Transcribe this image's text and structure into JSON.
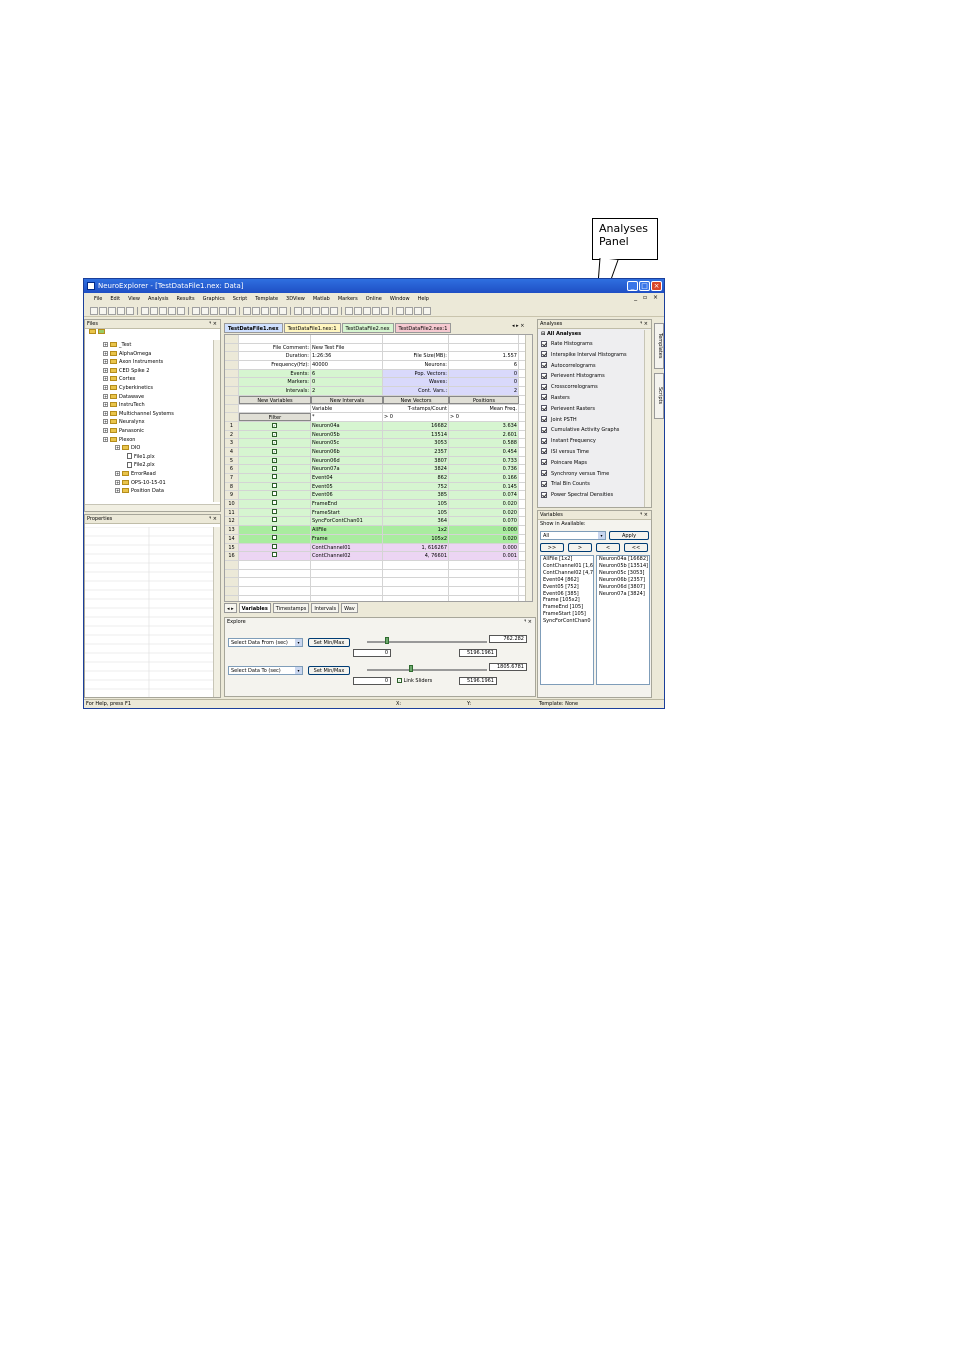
{
  "callout": {
    "line1": "Analyses",
    "line2": "Panel"
  },
  "window": {
    "title": "NeuroExplorer - [TestDataFile1.nex: Data]",
    "status": {
      "help": "For Help, press F1",
      "x": "X:",
      "y": "Y:",
      "template": "Template: None"
    }
  },
  "menu": [
    "File",
    "Edit",
    "View",
    "Analysis",
    "Results",
    "Graphics",
    "Script",
    "Template",
    "3DView",
    "Matlab",
    "Markers",
    "Online",
    "Window",
    "Help"
  ],
  "files_panel": {
    "title": "Files",
    "items": [
      {
        "label": "_Test",
        "level": 1,
        "kind": "folder"
      },
      {
        "label": "AlphaOmega",
        "level": 1,
        "kind": "folder"
      },
      {
        "label": "Axon Instruments",
        "level": 1,
        "kind": "folder"
      },
      {
        "label": "CED Spike 2",
        "level": 1,
        "kind": "folder"
      },
      {
        "label": "Cortex",
        "level": 1,
        "kind": "folder"
      },
      {
        "label": "Cyberkinetics",
        "level": 1,
        "kind": "folder"
      },
      {
        "label": "Datawave",
        "level": 1,
        "kind": "folder"
      },
      {
        "label": "InstruTech",
        "level": 1,
        "kind": "folder"
      },
      {
        "label": "Multichannel Systems",
        "level": 1,
        "kind": "folder"
      },
      {
        "label": "Neuralynx",
        "level": 1,
        "kind": "folder"
      },
      {
        "label": "Panasonic",
        "level": 1,
        "kind": "folder"
      },
      {
        "label": "Plexon",
        "level": 1,
        "kind": "folder"
      },
      {
        "label": "DIO",
        "level": 2,
        "kind": "folder"
      },
      {
        "label": "File1.plx",
        "level": 3,
        "kind": "file"
      },
      {
        "label": "File2.plx",
        "level": 3,
        "kind": "file"
      },
      {
        "label": "ErrorRead",
        "level": 2,
        "kind": "folder"
      },
      {
        "label": "OPS-10-15-01",
        "level": 2,
        "kind": "folder"
      },
      {
        "label": "Position Data",
        "level": 2,
        "kind": "folder"
      }
    ]
  },
  "properties_panel": {
    "title": "Properties"
  },
  "doc_tabs": [
    "TestDataFile1.nex",
    "TestDataFile1.nex:1",
    "TestDataFile2.nex",
    "TestDataFile2.nex:1"
  ],
  "summary": [
    {
      "l1": "File Comment:",
      "v1": "New Test File",
      "l2": "",
      "v2": ""
    },
    {
      "l1": "Duration:",
      "v1": "1:26:36",
      "l2": "File Size(MB):",
      "v2": "1.557"
    },
    {
      "l1": "Frequency(Hz):",
      "v1": "40000",
      "l2": "Neurons:",
      "v2": "6"
    },
    {
      "l1": "Events:",
      "v1": "6",
      "l2": "Pop. Vectors:",
      "v2": "0"
    },
    {
      "l1": "Markers:",
      "v1": "0",
      "l2": "Waves:",
      "v2": "0"
    },
    {
      "l1": "Intervals:",
      "v1": "2",
      "l2": "Cont. Vars.:",
      "v2": "2"
    }
  ],
  "new_buttons": [
    "New Variables",
    "New Intervals",
    "New Vectors",
    "Positions"
  ],
  "headers": {
    "variable": "Variable",
    "tstamps": "T-stamps/Count",
    "mean": "Mean Freq."
  },
  "filter": {
    "label": "Filter",
    "var": "*",
    "cnt": "> 0",
    "mean": "> 0"
  },
  "rows": [
    {
      "n": "1",
      "name": "Neuron04a",
      "count": "16682",
      "freq": "3.634",
      "checked": true,
      "color": "green"
    },
    {
      "n": "2",
      "name": "Neuron05b",
      "count": "13514",
      "freq": "2.601",
      "checked": true,
      "color": "green"
    },
    {
      "n": "3",
      "name": "Neuron05c",
      "count": "3053",
      "freq": "0.588",
      "checked": true,
      "color": "green"
    },
    {
      "n": "4",
      "name": "Neuron06b",
      "count": "2357",
      "freq": "0.454",
      "checked": true,
      "color": "green"
    },
    {
      "n": "5",
      "name": "Neuron06d",
      "count": "3807",
      "freq": "0.733",
      "checked": true,
      "color": "green"
    },
    {
      "n": "6",
      "name": "Neuron07a",
      "count": "3824",
      "freq": "0.736",
      "checked": true,
      "color": "green"
    },
    {
      "n": "7",
      "name": "Event04",
      "count": "862",
      "freq": "0.166",
      "checked": false,
      "color": "green"
    },
    {
      "n": "8",
      "name": "Event05",
      "count": "752",
      "freq": "0.145",
      "checked": false,
      "color": "green"
    },
    {
      "n": "9",
      "name": "Event06",
      "count": "385",
      "freq": "0.074",
      "checked": false,
      "color": "green"
    },
    {
      "n": "10",
      "name": "FrameEnd",
      "count": "105",
      "freq": "0.020",
      "checked": false,
      "color": "green"
    },
    {
      "n": "11",
      "name": "FrameStart",
      "count": "105",
      "freq": "0.020",
      "checked": false,
      "color": "green"
    },
    {
      "n": "12",
      "name": "SyncForContChan01",
      "count": "364",
      "freq": "0.070",
      "checked": false,
      "color": "green"
    },
    {
      "n": "13",
      "name": "AllFile",
      "count": "1x2",
      "freq": "0.000",
      "checked": false,
      "color": "dgreen"
    },
    {
      "n": "14",
      "name": "Frame",
      "count": "105x2",
      "freq": "0.020",
      "checked": false,
      "color": "dgreen"
    },
    {
      "n": "15",
      "name": "ContChannel01",
      "count": "1, 616267",
      "freq": "0.000",
      "checked": false,
      "color": "pink"
    },
    {
      "n": "16",
      "name": "ContChannel02",
      "count": "4, 76601",
      "freq": "0.001",
      "checked": false,
      "color": "pink"
    }
  ],
  "bottom_tabs": [
    "Variables",
    "Timestamps",
    "Intervals",
    "Wav"
  ],
  "explore": {
    "title": "Explore",
    "from_label": "Select Data From (sec)",
    "to_label": "Select Data To (sec)",
    "setminmax": "Set Min/Max",
    "from_value": "762.282",
    "to_value": "1805.6781",
    "min": "0",
    "max": "5196.1961",
    "from_pos": 0.147,
    "to_pos": 0.347,
    "link": "Link Sliders"
  },
  "analyses": {
    "title": "Analyses",
    "all": "All Analyses",
    "items": [
      "Rate Histograms",
      "Interspike Interval Histograms",
      "Autocorrelograms",
      "Perievent Histograms",
      "Crosscorrelograms",
      "Rasters",
      "Perievent Rasters",
      "Joint PSTH",
      "Cumulative Activity Graphs",
      "Instant Frequency",
      "ISI versus Time",
      "Poincare Maps",
      "Synchrony versus Time",
      "Trial Bin Counts",
      "Power Spectral Densities"
    ]
  },
  "variables_panel": {
    "title": "Variables",
    "show_label": "Show in Available:",
    "select": "All",
    "apply": "Apply",
    "btns": [
      ">>",
      ">",
      "<",
      "<<"
    ],
    "available": [
      "AllFile [1x2]",
      "ContChannel01 [1,6",
      "ContChannel02 [4,7",
      "Event04 [862]",
      "Event05 [752]",
      "Event06 [385]",
      "Frame [105x2]",
      "FrameEnd [105]",
      "FrameStart [105]",
      "SyncForContChan0"
    ],
    "selected": [
      "Neuron04a [16682]",
      "Neuron05b [13514]",
      "Neuron05c [3053]",
      "Neuron06b [2357]",
      "Neuron06d [3807]",
      "Neuron07a [3824]"
    ]
  },
  "side_tabs": [
    "Templates",
    "Scripts"
  ]
}
